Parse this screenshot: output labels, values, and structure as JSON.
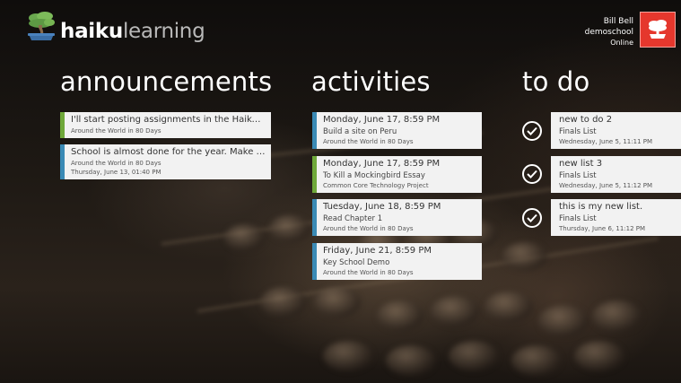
{
  "app": {
    "logo_haiku": "haiku",
    "logo_learning": "learning",
    "logo_icon": "bonsai-tree-icon"
  },
  "user": {
    "name": "Bill Bell",
    "school": "demoschool",
    "status": "Online",
    "avatar_icon": "bonsai-tree-icon",
    "avatar_color": "#e5372d"
  },
  "sections": {
    "announcements": "announcements",
    "activities": "activities",
    "todo": "to do"
  },
  "announcements": [
    {
      "title": "I'll start posting assignments in the Haiku class...",
      "class": "Around the World in 80 Days",
      "date": ""
    },
    {
      "title": "School is almost done for the year. Make sure to...",
      "class": "Around the World in 80 Days",
      "date": "Thursday, June 13, 01:40 PM"
    }
  ],
  "activities": [
    {
      "date": "Monday, June 17, 8:59 PM",
      "title": "Build a site on Peru",
      "class": "Around the World in 80 Days",
      "accent": "#3a8ab5"
    },
    {
      "date": "Monday, June 17, 8:59 PM",
      "title": "To Kill a Mockingbird Essay",
      "class": "Common Core Technology Project",
      "accent": "#6fa83a"
    },
    {
      "date": "Tuesday, June 18, 8:59 PM",
      "title": "Read Chapter 1",
      "class": "Around the World in 80 Days",
      "accent": "#3a8ab5"
    },
    {
      "date": "Friday, June 21, 8:59 PM",
      "title": "Key School Demo",
      "class": "Around the World in 80 Days",
      "accent": "#3a8ab5"
    }
  ],
  "todos": [
    {
      "title": "new to do 2",
      "list": "Finals List",
      "date": "Wednesday, June 5, 11:11 PM",
      "icon": "checkmark-circle-icon"
    },
    {
      "title": "new list 3",
      "list": "Finals List",
      "date": "Wednesday, June 5, 11:12 PM",
      "icon": "checkmark-circle-icon"
    },
    {
      "title": "this is my new list.",
      "list": "Finals List",
      "date": "Thursday, June 6, 11:12 PM",
      "icon": "checkmark-circle-icon"
    }
  ],
  "colors": {
    "blue_accent": "#3a8ab5",
    "green_accent": "#6fa83a",
    "tile_bg": "#f2f2f2"
  }
}
